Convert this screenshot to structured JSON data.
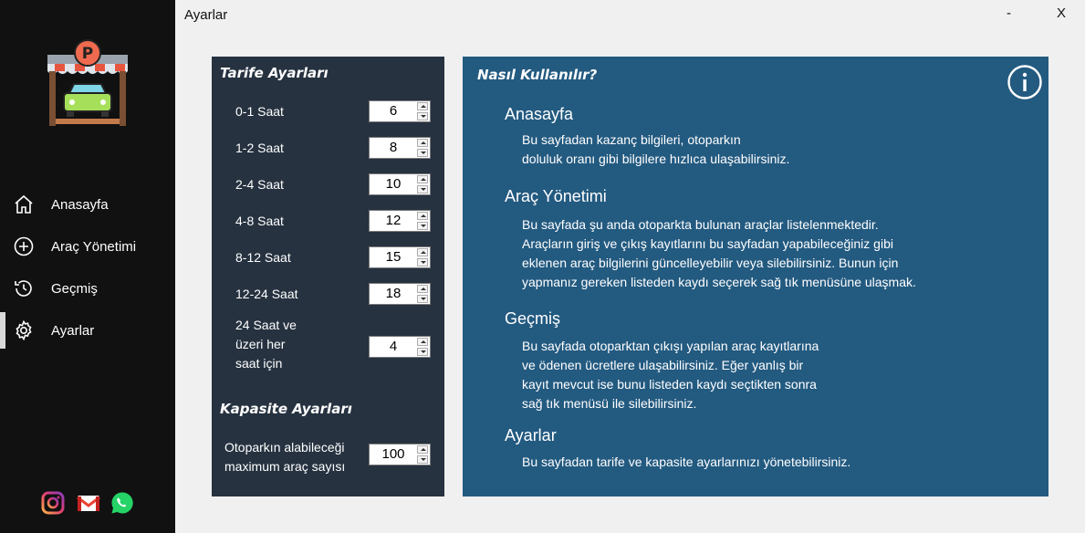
{
  "window": {
    "title": "Ayarlar",
    "minimize_label": "-",
    "close_label": "X"
  },
  "sidebar": {
    "logo_icon": "parking-garage-icon",
    "items": [
      {
        "label": "Anasayfa",
        "icon": "home-icon",
        "active": false
      },
      {
        "label": "Araç Yönetimi",
        "icon": "plus-circle-icon",
        "active": false
      },
      {
        "label": "Geçmiş",
        "icon": "history-icon",
        "active": false
      },
      {
        "label": "Ayarlar",
        "icon": "gear-icon",
        "active": true
      }
    ],
    "social": [
      "instagram-icon",
      "gmail-icon",
      "whatsapp-icon"
    ]
  },
  "tariff": {
    "title": "Tarife Ayarları",
    "rows": [
      {
        "label": "0-1 Saat",
        "value": "6"
      },
      {
        "label": "1-2 Saat",
        "value": "8"
      },
      {
        "label": "2-4 Saat",
        "value": "10"
      },
      {
        "label": "4-8 Saat",
        "value": "12"
      },
      {
        "label": "8-12 Saat",
        "value": "15"
      },
      {
        "label": "12-24 Saat",
        "value": "18"
      }
    ],
    "over24": {
      "line1": "24 Saat ve",
      "line2": "üzeri her",
      "line3": "saat için",
      "value": "4"
    }
  },
  "capacity": {
    "title": "Kapasite Ayarları",
    "label_line1": "Otoparkın alabileceği",
    "label_line2": "maximum araç sayısı",
    "value": "100"
  },
  "help": {
    "title": "Nasıl Kullanılır?",
    "info_icon": "info-icon",
    "sections": [
      {
        "heading": "Anasayfa",
        "text": "Bu sayfadan kazanç bilgileri, otoparkın\ndoluluk oranı gibi bilgilere hızlıca ulaşabilirsiniz."
      },
      {
        "heading": "Araç Yönetimi",
        "text": "Bu sayfada şu anda otoparkta bulunan araçlar listelenmektedir.\nAraçların giriş ve çıkış kayıtlarını bu sayfadan yapabileceğiniz gibi\neklenen araç bilgilerini güncelleyebilir veya silebilirsiniz. Bunun için\nyapmanız gereken listeden kaydı seçerek sağ tık menüsüne ulaşmak."
      },
      {
        "heading": "Geçmiş",
        "text": "Bu sayfada otoparktan çıkışı yapılan araç kayıtlarına\nve ödenen ücretlere ulaşabilirsiniz. Eğer yanlış bir\nkayıt mevcut ise bunu listeden kaydı seçtikten sonra\nsağ tık menüsü ile silebilirsiniz."
      },
      {
        "heading": "Ayarlar",
        "text": "Bu sayfadan tarife ve kapasite ayarlarınızı yönetebilirsiniz."
      }
    ]
  },
  "colors": {
    "sidebar_bg": "#111111",
    "tariff_panel_bg": "#263240",
    "help_panel_bg": "#235a80",
    "page_bg": "#f0f0f0"
  }
}
